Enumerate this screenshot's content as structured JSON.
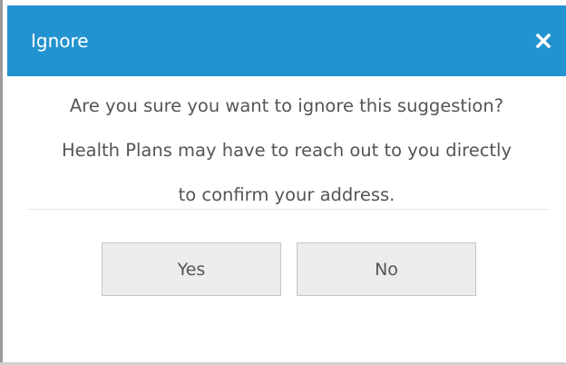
{
  "dialog": {
    "title": "Ignore",
    "close_icon": "close-icon",
    "message_lines": [
      "Are you sure you want to ignore this suggestion?",
      "Health Plans may have to reach out to you directly",
      "to confirm your address."
    ],
    "buttons": {
      "yes_label": "Yes",
      "no_label": "No"
    }
  },
  "colors": {
    "titlebar": "#2393cf",
    "title_text": "#ffffff",
    "body_text": "#555555",
    "button_bg": "#ececec",
    "button_border": "#c6c6c6",
    "divider": "#e6e6e6"
  }
}
